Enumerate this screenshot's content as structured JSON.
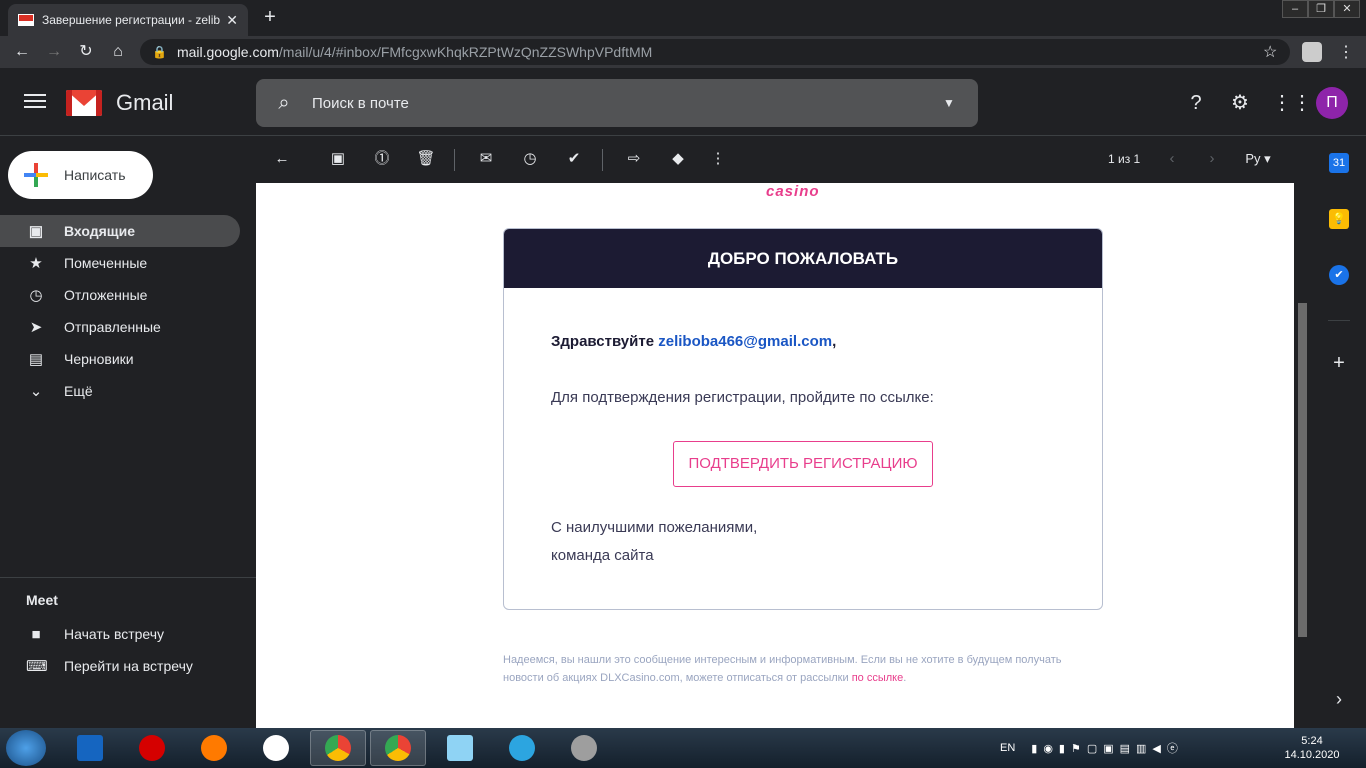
{
  "browser": {
    "tab_title": "Завершение регистрации - zelib",
    "url_host": "mail.google.com",
    "url_path": "/mail/u/4/#inbox/FMfcgxwKhqkRZPtWzQnZZSWhpVPdftMM"
  },
  "gmail": {
    "brand": "Gmail",
    "search_placeholder": "Поиск в почте",
    "avatar_letter": "П",
    "compose_label": "Написать",
    "nav": [
      {
        "label": "Входящие",
        "icon": "inbox-icon",
        "active": true
      },
      {
        "label": "Помеченные",
        "icon": "star-icon"
      },
      {
        "label": "Отложенные",
        "icon": "clock-icon"
      },
      {
        "label": "Отправленные",
        "icon": "send-icon"
      },
      {
        "label": "Черновики",
        "icon": "draft-icon"
      },
      {
        "label": "Ещё",
        "icon": "chevron-down-icon"
      }
    ],
    "meet": {
      "title": "Meet",
      "items": [
        {
          "label": "Начать встречу",
          "icon": "video-icon"
        },
        {
          "label": "Перейти на встречу",
          "icon": "keyboard-icon"
        }
      ]
    },
    "pager": "1 из 1",
    "input_tool": "Ру"
  },
  "email": {
    "brand_word": "casino",
    "header": "ДОБРО ПОЖАЛОВАТЬ",
    "greeting_prefix": "Здравствуйте ",
    "greeting_email": "zeliboba466@gmail.com",
    "greeting_suffix": ",",
    "instruction": "Для подтверждения регистрации, пройдите по ссылке:",
    "confirm_button": "ПОДТВЕРДИТЬ РЕГИСТРАЦИЮ",
    "signoff_line1": "С наилучшими пожеланиями,",
    "signoff_line2": "команда сайта",
    "footer_text": "Надеемся, вы нашли это сообщение интересным и информативным. Если вы не хотите в будущем получать новости об акциях DLXCasino.com, можете отписаться от рассылки ",
    "footer_link": "по ссылке",
    "footer_end": "."
  },
  "rightpanel": {
    "calendar_day": "31"
  },
  "taskbar": {
    "lang": "EN",
    "time": "5:24",
    "date": "14.10.2020"
  },
  "colors": {
    "accent_pink": "#e83e8c",
    "header_navy": "#1c1b33",
    "link_blue": "#1a56c4"
  }
}
